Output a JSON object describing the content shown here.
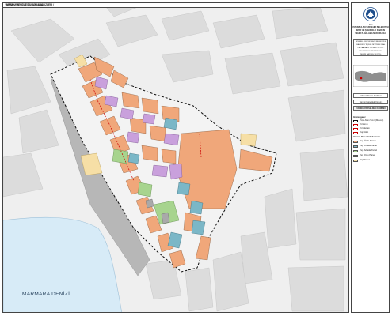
{
  "map_header": {
    "title": "MEŞRÜ MEVCUT DURUM ANALİZLERİ /",
    "subtitle": "YAPININ PARSELDEKİ KONUMU"
  },
  "sea_label": "MARMARA DENİZİ",
  "panel": {
    "org_lines": [
      "T.C.",
      "İSTANBUL BÜYÜKŞEHİR BELEDİYESİ",
      "İMAR VE ŞEHİRCİLİK DAİRESİ",
      "ŞEHİR PLANLAMA MÜDÜRLÜĞÜ"
    ],
    "project_lines": [
      "İSTANBUL BÜYÜKŞEHİR BELEDİYESİ",
      "BAKIRKÖY İLÇESİ ZEYTİNLİK MAH.",
      "PAFTA ANALİZ VE MEVCUT DU...",
      "BELLEME KOORDİNATLARI...",
      "TEKNİK RAPORU ZEYTİN..."
    ],
    "section_a": "Mevcut Durum Analizleri",
    "section_b": "Yapının Parseldeki Konumu",
    "section_title": "YAPININ PARSELDEKİ KONUMU",
    "legend_title": "Göstergeler",
    "legend_items": [
      {
        "label": "Proje Alanı Sınırı (Mevcut)",
        "color": "#ffffff",
        "border": "#111111",
        "dashed": true
      },
      {
        "label": "Yol Sınırı",
        "color": "#ffffff",
        "border": "#cc0000",
        "dashed": true
      },
      {
        "label": "Yol Alanları",
        "color": "#ffffff",
        "border": "#cc0000",
        "dashed": false
      },
      {
        "label": "Yeşil Alan",
        "color": "#ffffff",
        "border": "#cc0000",
        "dashed": true
      }
    ],
    "parcel_title": "Yapının Parseldeki Konumu",
    "parcel_items": [
      {
        "label": "Yapı Önde Parsel",
        "color": "#f0a77a"
      },
      {
        "label": "Yapı Ortada Parsel",
        "color": "#7bb7c7"
      },
      {
        "label": "Yapı Arkada Parsel",
        "color": "#a7d48e"
      },
      {
        "label": "Yapı Ordu Parsel",
        "color": "#c9a0dc"
      },
      {
        "label": "Boş Parsel",
        "color": "#f6dfa6"
      }
    ]
  },
  "colors": {
    "front_parcel": "#f0a77a",
    "middle_parcel": "#7bb7c7",
    "back_parcel": "#a7d48e",
    "corner_parcel": "#c9a0dc",
    "empty_parcel": "#f6dfa6",
    "sea": "#d7ebf7",
    "block": "#d9d9d9",
    "road": "#f4f4f4"
  }
}
